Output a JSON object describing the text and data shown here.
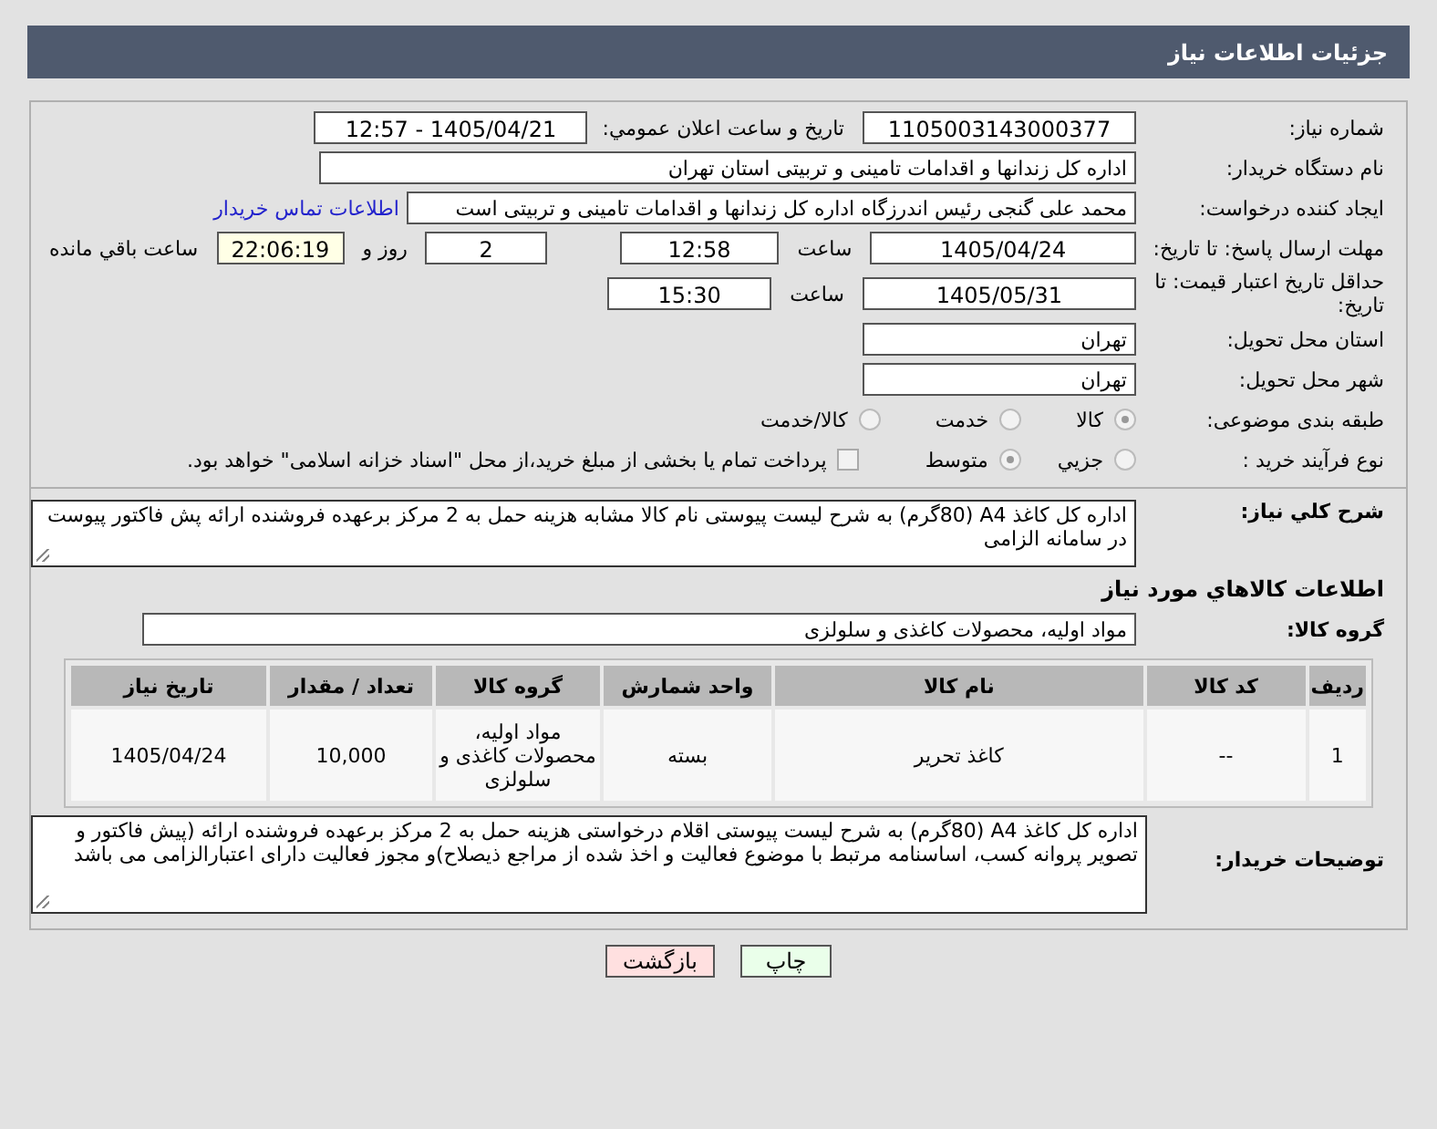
{
  "header": {
    "title": "جزئیات اطلاعات نیاز"
  },
  "need_number": {
    "label": "شماره نیاز:",
    "value": "1105003143000377"
  },
  "announce": {
    "label": "تاریخ و ساعت اعلان عمومي:",
    "value": "1405/04/21 - 12:57"
  },
  "buyer_org": {
    "label": "نام دستگاه خریدار:",
    "value": "اداره کل زندانها و اقدامات تامینی و تربیتی استان تهران"
  },
  "requester": {
    "label": "ایجاد کننده درخواست:",
    "value": "محمد علی گنجی رئیس اندرزگاه  اداره کل زندانها و اقدامات تامینی و تربیتی است",
    "link": "اطلاعات تماس خریدار"
  },
  "deadline": {
    "label": "مهلت ارسال پاسخ: تا تاریخ:",
    "date": "1405/04/24",
    "time_label": "ساعت",
    "time": "12:58",
    "days": "2",
    "days_label": "روز و",
    "remaining": "22:06:19",
    "remaining_label": "ساعت باقي مانده"
  },
  "price_validity": {
    "label": "حداقل تاریخ اعتبار قیمت: تا تاریخ:",
    "date": "1405/05/31",
    "time_label": "ساعت",
    "time": "15:30"
  },
  "province": {
    "label": "استان محل تحویل:",
    "value": "تهران"
  },
  "city": {
    "label": "شهر محل تحویل:",
    "value": "تهران"
  },
  "category": {
    "label": "طبقه بندی موضوعی:",
    "options": [
      {
        "label": "کالا",
        "selected": true
      },
      {
        "label": "خدمت",
        "selected": false
      },
      {
        "label": "کالا/خدمت",
        "selected": false
      }
    ]
  },
  "process": {
    "label": "نوع فرآیند خرید :",
    "options": [
      {
        "label": "جزیي",
        "selected": false
      },
      {
        "label": "متوسط",
        "selected": true
      }
    ],
    "treasury": {
      "label": "پرداخت تمام یا بخشی از مبلغ خرید،از محل \"اسناد خزانه اسلامی\" خواهد بود.",
      "checked": false
    }
  },
  "description": {
    "label": "شرح کلي نیاز:",
    "value": "اداره کل کاغذ A4 (80گرم) به شرح لیست پیوستی نام کالا مشابه هزینه حمل به 2 مرکز برعهده فروشنده ارائه پش فاکتور پیوست در سامانه الزامی"
  },
  "goods_title": "اطلاعات کالاهاي مورد نیاز",
  "goods_group": {
    "label": "گروه کالا:",
    "value": "مواد اولیه، محصولات کاغذی و سلولزی"
  },
  "table": {
    "columns": [
      "ردیف",
      "کد کالا",
      "نام کالا",
      "واحد شمارش",
      "گروه کالا",
      "تعداد / مقدار",
      "تاریخ نیاز"
    ],
    "rows": [
      [
        "1",
        "--",
        "کاغذ تحریر",
        "بسته",
        "مواد اولیه، محصولات کاغذی و سلولزی",
        "10,000",
        "1405/04/24"
      ]
    ]
  },
  "buyer_notes": {
    "label": "توضیحات خریدار:",
    "value": "اداره کل کاغذ A4 (80گرم) به شرح لیست پیوستی اقلام درخواستی  هزینه حمل به 2 مرکز برعهده فروشنده ارائه (پیش فاکتور و  تصویر پروانه کسب، اساسنامه مرتبط با موضوع فعالیت و اخذ شده از مراجع ذیصلاح)و مجوز فعالیت دارای اعتبارالزامی می باشد"
  },
  "buttons": [
    {
      "label": "چاپ",
      "kind": "print"
    },
    {
      "label": "بازگشت",
      "kind": "back"
    }
  ]
}
